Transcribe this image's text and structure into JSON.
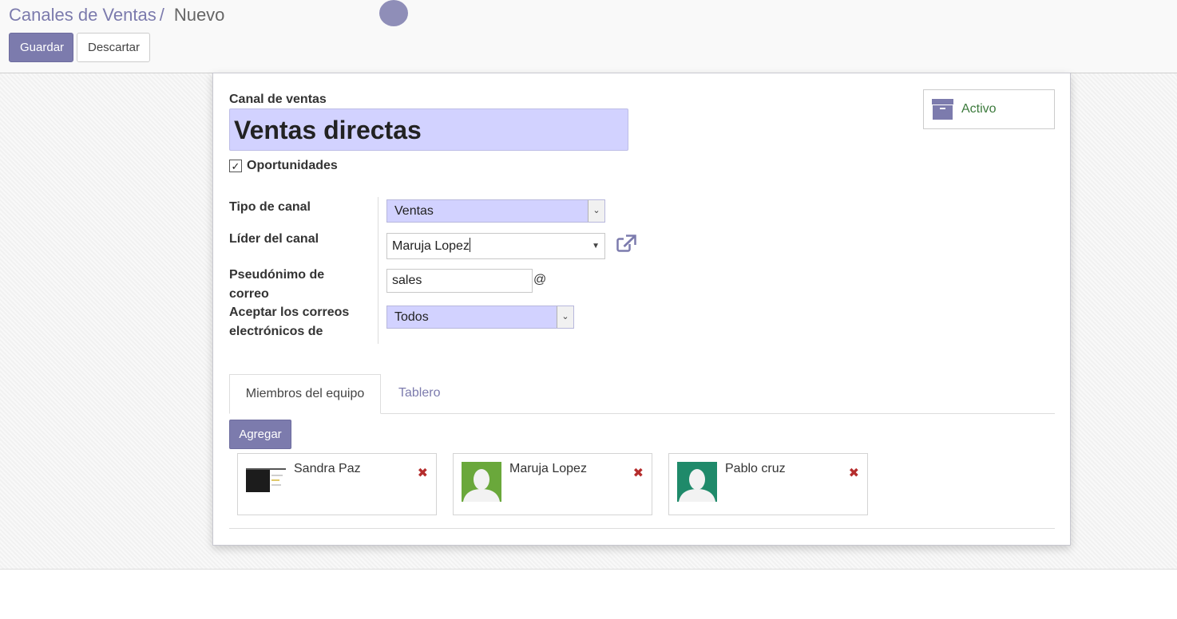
{
  "breadcrumb": {
    "parent": "Canales de Ventas",
    "separator": "/",
    "current": "Nuevo"
  },
  "toolbar": {
    "save_label": "Guardar",
    "discard_label": "Descartar"
  },
  "form": {
    "name_label": "Canal de ventas",
    "name_value": "Ventas directas",
    "opportunities_label": "Oportunidades",
    "opportunities_checked": true,
    "active_label": "Activo",
    "fields": {
      "team_type_label": "Tipo de canal",
      "team_type_value": "Ventas",
      "leader_label": "Líder del canal",
      "leader_value": "Maruja Lopez",
      "alias_label": "Pseudónimo de correo",
      "alias_value": "sales",
      "alias_suffix": "@",
      "accept_label": "Aceptar los correos electrónicos de",
      "accept_value": "Todos"
    }
  },
  "tabs": [
    {
      "label": "Miembros del equipo",
      "active": true
    },
    {
      "label": "Tablero",
      "active": false
    }
  ],
  "members": {
    "add_label": "Agregar",
    "items": [
      {
        "name": "Sandra Paz",
        "avatar": "screenshot-thumbnail",
        "avatar_bg": "#1c1c1c"
      },
      {
        "name": "Maruja Lopez",
        "avatar": "person-silhouette",
        "avatar_bg": "#6aa83b"
      },
      {
        "name": "Pablo cruz",
        "avatar": "person-silhouette",
        "avatar_bg": "#1f8a6a"
      }
    ],
    "delete_icon": "✖"
  },
  "colors": {
    "accent": "#7c7bad",
    "required_bg": "#d2d2ff",
    "active_green": "#3c7a3c",
    "delete_red": "#b52d2d"
  }
}
